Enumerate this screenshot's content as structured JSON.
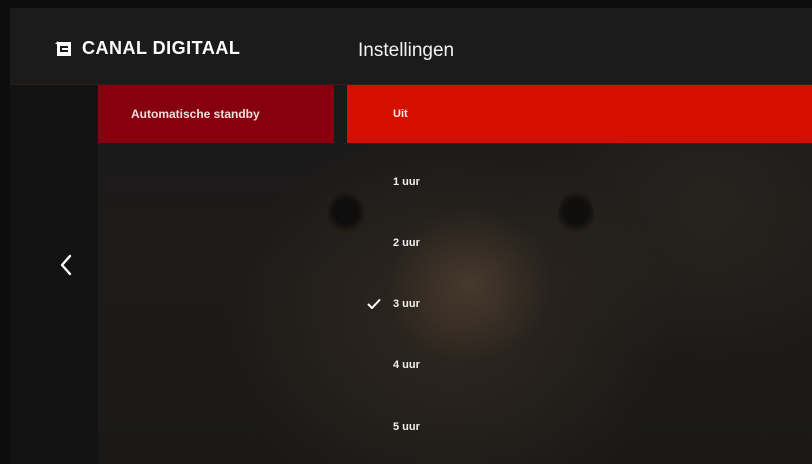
{
  "header": {
    "brand": "CANAL DIGITAAL",
    "title": "Instellingen"
  },
  "sidebar": {
    "category_label": "Automatische standby"
  },
  "options": [
    {
      "label": "Uit",
      "focused": true,
      "checked": false
    },
    {
      "label": "1 uur",
      "focused": false,
      "checked": false
    },
    {
      "label": "2 uur",
      "focused": false,
      "checked": false
    },
    {
      "label": "3 uur",
      "focused": false,
      "checked": true
    },
    {
      "label": "4 uur",
      "focused": false,
      "checked": false
    },
    {
      "label": "5 uur",
      "focused": false,
      "checked": false
    }
  ],
  "icons": {
    "brand": "canal-digitaal-logo-icon",
    "back": "chevron-left-icon",
    "check": "checkmark-icon"
  },
  "colors": {
    "focus": "#d40f00",
    "category": "#86000d",
    "background": "#151515"
  }
}
